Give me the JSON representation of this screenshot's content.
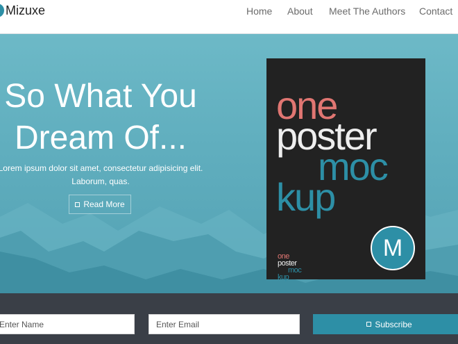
{
  "brand": {
    "name": "Mizuxe",
    "logo_icon": "circle-logo-icon",
    "color": "#2d8fa6"
  },
  "nav": {
    "items": [
      {
        "label": "Home"
      },
      {
        "label": "About"
      },
      {
        "label": "Meet The Authors"
      },
      {
        "label": "Contact"
      }
    ]
  },
  "hero": {
    "title_line1": "So What You",
    "title_line2": "Dream Of...",
    "text_line1": "Lorem ipsum dolor sit amet, consectetur adipisicing elit.",
    "text_line2": "Laborum, quas.",
    "button_label": "Read More",
    "button_icon": "square-icon"
  },
  "poster": {
    "line1": "one",
    "line2": "poster",
    "line3": "moc",
    "line4": "kup",
    "logo_letter": "M",
    "colors": {
      "one": "#e07672",
      "poster": "#eeeeee",
      "mockup": "#2d8fa6",
      "background": "#222222"
    }
  },
  "subscribe": {
    "name_placeholder": "Enter Name",
    "email_placeholder": "Enter Email",
    "button_label": "Subscribe",
    "button_icon": "square-icon"
  }
}
